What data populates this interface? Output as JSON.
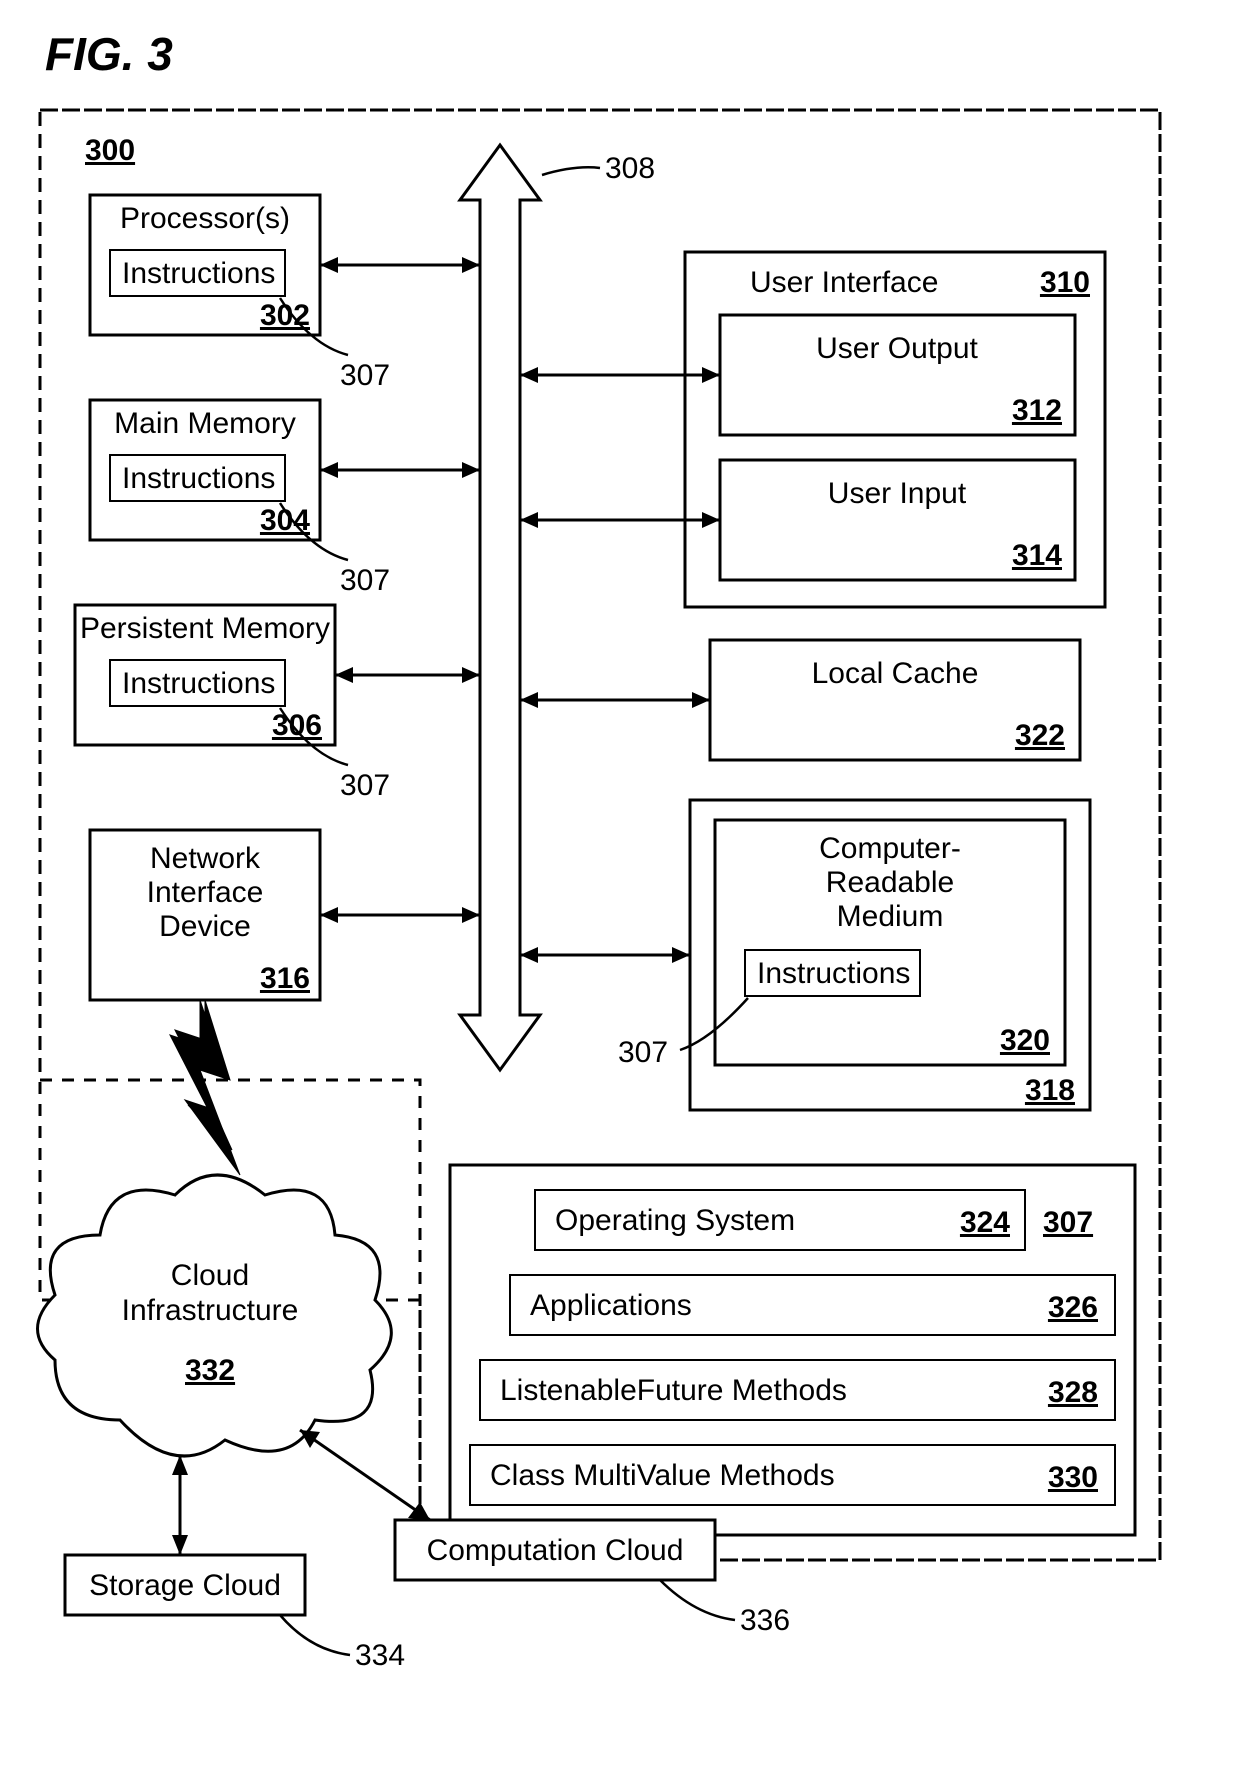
{
  "figure_title": "FIG. 3",
  "system_ref": "300",
  "bus_ref": "308",
  "lead_ref": "307",
  "blocks": {
    "processor": {
      "title": "Processor(s)",
      "inner": "Instructions",
      "ref": "302"
    },
    "main_memory": {
      "title": "Main Memory",
      "inner": "Instructions",
      "ref": "304"
    },
    "persistent_memory": {
      "title": "Persistent Memory",
      "inner": "Instructions",
      "ref": "306"
    },
    "network_iface": {
      "line1": "Network",
      "line2": "Interface",
      "line3": "Device",
      "ref": "316"
    },
    "ui": {
      "title": "User Interface",
      "ref": "310",
      "output": {
        "title": "User Output",
        "ref": "312"
      },
      "input": {
        "title": "User Input",
        "ref": "314"
      }
    },
    "local_cache": {
      "title": "Local Cache",
      "ref": "322"
    },
    "drive": {
      "ref": "318",
      "medium": {
        "line1": "Computer-",
        "line2": "Readable",
        "line3": "Medium",
        "inner": "Instructions",
        "ref": "320"
      }
    },
    "software": {
      "os": {
        "title": "Operating System",
        "ref": "324"
      },
      "apps": {
        "title": "Applications",
        "ref": "326"
      },
      "lfm": {
        "title": "ListenableFuture Methods",
        "ref": "328"
      },
      "cmv": {
        "title": "Class MultiValue Methods",
        "ref": "330"
      },
      "side_ref": "307"
    },
    "cloud": {
      "line1": "Cloud",
      "line2": "Infrastructure",
      "ref": "332"
    },
    "storage_cloud": {
      "title": "Storage Cloud",
      "ref": "334"
    },
    "computation_cloud": {
      "title": "Computation Cloud",
      "ref": "336"
    }
  }
}
